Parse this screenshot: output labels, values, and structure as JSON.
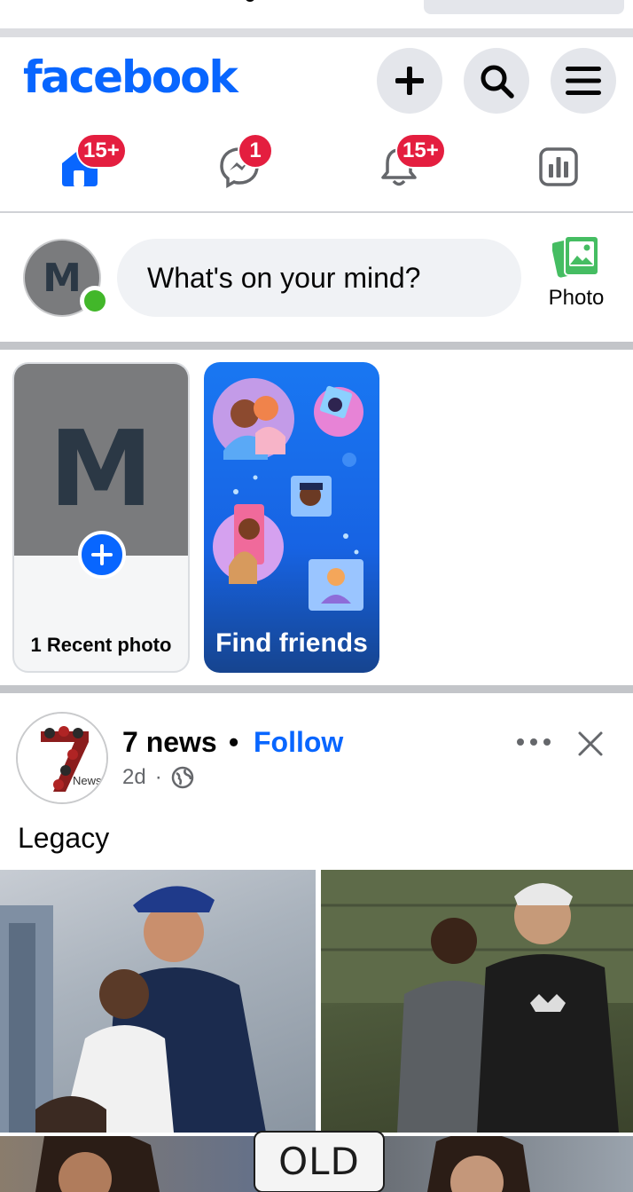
{
  "app": {
    "logo_text": "facebook",
    "brand_color": "#0866ff"
  },
  "header": {
    "buttons": [
      {
        "name": "create",
        "icon": "plus-icon"
      },
      {
        "name": "search",
        "icon": "search-icon"
      },
      {
        "name": "menu",
        "icon": "hamburger-menu-icon"
      }
    ]
  },
  "nav": {
    "items": [
      {
        "name": "home",
        "icon": "home-icon",
        "badge": "15+",
        "active": true
      },
      {
        "name": "messenger",
        "icon": "messenger-icon",
        "badge": "1"
      },
      {
        "name": "notifications",
        "icon": "bell-icon",
        "badge": "15+"
      },
      {
        "name": "dashboard",
        "icon": "dashboard-icon"
      }
    ]
  },
  "composer": {
    "avatar_letter": "M",
    "placeholder": "What's on your mind?",
    "photo_label": "Photo"
  },
  "stories": {
    "recent_letter": "M",
    "recent_label": "1 Recent photo",
    "find_friends_label": "Find friends"
  },
  "post": {
    "page_name": "7 news",
    "separator": "•",
    "follow_label": "Follow",
    "time": "2d",
    "meta_separator": "·",
    "caption": "Legacy",
    "overlay_label": "OLD",
    "avatar_text": "News"
  }
}
